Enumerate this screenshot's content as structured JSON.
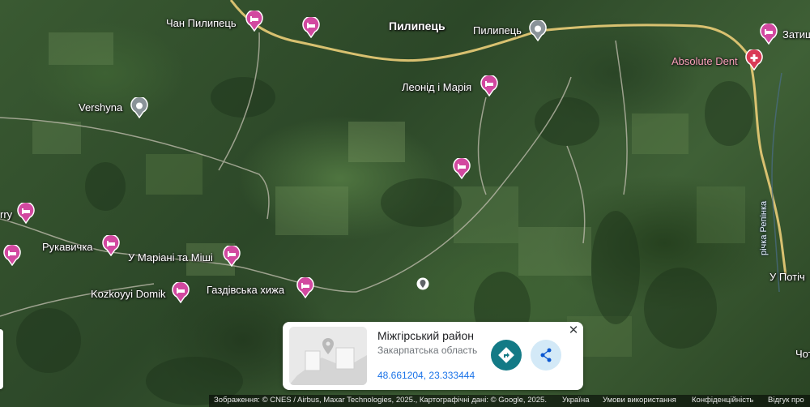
{
  "map": {
    "places": {
      "chan_pylypets": "Чан Пилипець",
      "pylypets_village": "Пилипець",
      "pylypets_pin": "Пилипець",
      "leonid_mariia": "Леонід і Марія",
      "vershyna": "Vershyna",
      "zatyshok": "Затиш",
      "absolute_dent": "Absolute Dent",
      "rry": "rry",
      "rukavychka": "Рукавичка",
      "u_mariani": "У Маріані та Міші",
      "kozkovyi_domik": "Kozkoyyi Domik",
      "gazdivska": "Газдівська хижа",
      "u_potich": "У Потіч",
      "chot": "Чот"
    },
    "river_label": "річка Репінка"
  },
  "card": {
    "title": "Міжгірський район",
    "subtitle": "Закарпатська область",
    "coordinates": "48.661204, 23.333444",
    "close_symbol": "✕"
  },
  "footer": {
    "attribution": "Зображення: © CNES / Airbus, Maxar Technologies, 2025., Картографічні дані: © Google, 2025.",
    "country": "Україна",
    "terms": "Умови використання",
    "privacy": "Конфіденційність",
    "feedback": "Відгук про"
  },
  "colors": {
    "hotel_pin": "#d248a0",
    "hospital_pin": "#d93a55",
    "place_pin": "#ffffff",
    "road": "#e2c774",
    "directions_button": "#137a86",
    "share_button": "#d3e9f7",
    "link": "#1a73e8"
  },
  "icons": {
    "hotel": "bed-icon",
    "place": "circle-dot-icon",
    "hospital": "medical-cross-icon",
    "directions": "directions-arrow-icon",
    "share": "share-icon",
    "close": "close-icon"
  }
}
